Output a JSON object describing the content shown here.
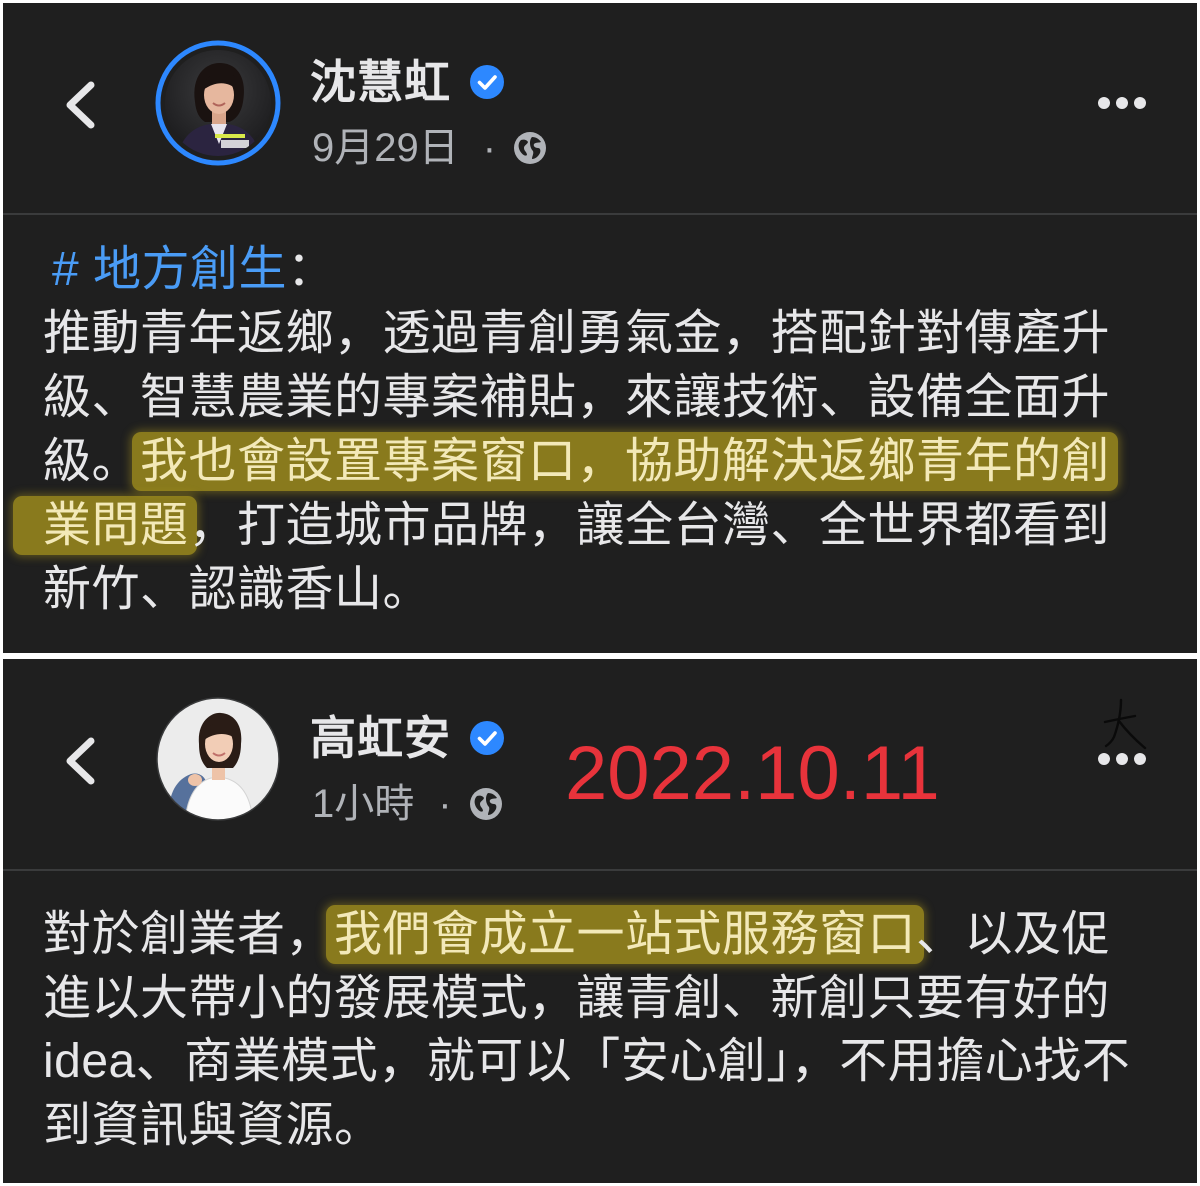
{
  "colors": {
    "page_border": "#ffffff",
    "panel_background": "#1f1f1f",
    "divider": "#3a3b3c",
    "primary_text": "#e7e7e9",
    "secondary_text": "#b0b3b8",
    "hashtag": "#4a9cf6",
    "verified_badge": "#2d88ff",
    "story_ring": "#2d88ff",
    "highlight": "#d6bb1c",
    "date_overlay": "#e8333b"
  },
  "posts": [
    {
      "back_icon": "chevron-left-icon",
      "author": "沈慧虹",
      "verified": true,
      "verified_icon": "verified-badge-icon",
      "timestamp": "9月29日",
      "separator": "·",
      "audience_icon": "globe-icon",
      "more_icon": "more-options-icon",
      "body_lines": [
        [
          {
            "text": "# 地方創生",
            "hashtag": true
          },
          {
            "text": "："
          }
        ],
        [
          {
            "text": "推動青年返鄉，透過青創勇氣金，搭配針對傳產升"
          }
        ],
        [
          {
            "text": "級、智慧農業的專案補貼，來讓技術、設備全面升"
          }
        ],
        [
          {
            "text": "級。"
          },
          {
            "text": "我也會設置專案窗口，協助解決返鄉青年的創",
            "highlighted": true
          }
        ],
        [
          {
            "text": "業問題",
            "highlighted": true
          },
          {
            "text": "，打造城市品牌，讓全台灣、全世界都看到"
          }
        ],
        [
          {
            "text": "新竹、認識香山。"
          }
        ]
      ]
    },
    {
      "back_icon": "chevron-left-icon",
      "author": "高虹安",
      "verified": true,
      "verified_icon": "verified-badge-icon",
      "timestamp": "1小時",
      "separator": "·",
      "audience_icon": "globe-icon",
      "more_icon": "more-options-icon",
      "body_lines": [
        [
          {
            "text": "對於創業者，"
          },
          {
            "text": "我們會成立一站式服務窗口",
            "highlighted": true
          },
          {
            "text": "、以及促"
          }
        ],
        [
          {
            "text": "進以大帶小的發展模式，讓青創、新創只要有好的"
          }
        ],
        [
          {
            "text": "idea、商業模式，就可以「安心創」，不用擔心找不"
          }
        ],
        [
          {
            "text": "到資訊與資源。"
          }
        ]
      ]
    }
  ],
  "annotations": {
    "date_overlay": "2022.10.11"
  }
}
